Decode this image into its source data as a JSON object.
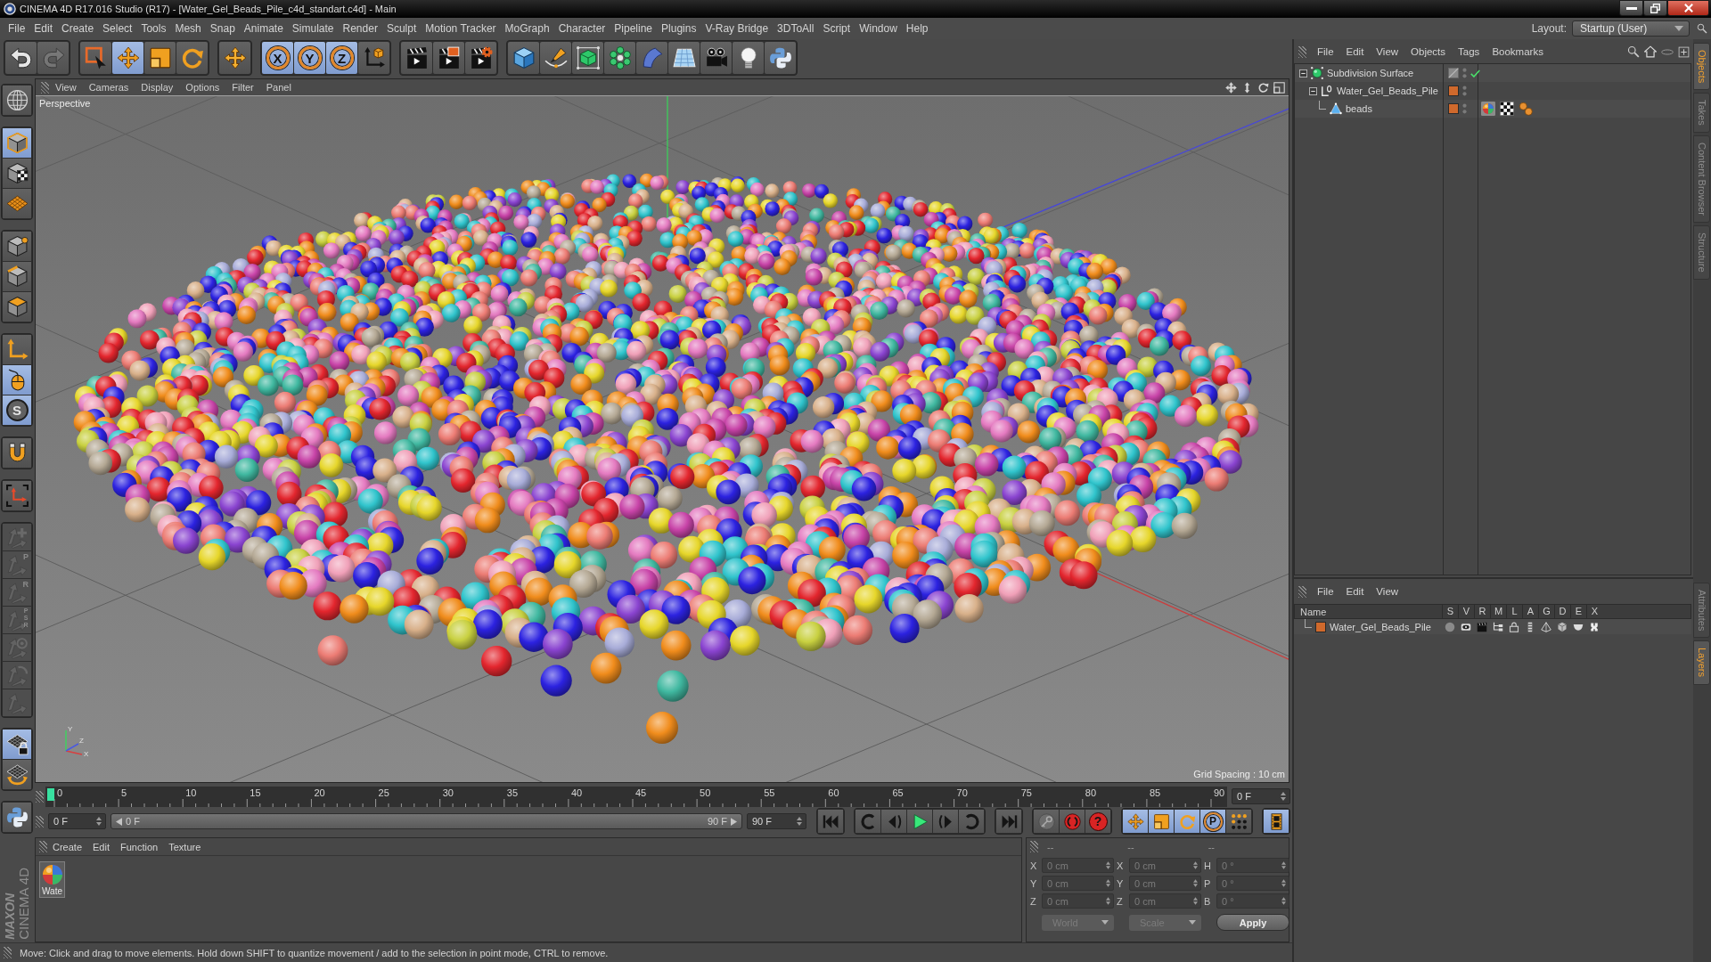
{
  "window": {
    "title": "CINEMA 4D R17.016 Studio (R17) - [Water_Gel_Beads_Pile_c4d_standart.c4d] - Main"
  },
  "menu_bar": {
    "items": [
      "File",
      "Edit",
      "Create",
      "Select",
      "Tools",
      "Mesh",
      "Snap",
      "Animate",
      "Simulate",
      "Render",
      "Sculpt",
      "Motion Tracker",
      "MoGraph",
      "Character",
      "Pipeline",
      "Plugins",
      "V-Ray Bridge",
      "3DToAll",
      "Script",
      "Window",
      "Help"
    ],
    "layout_label": "Layout:",
    "layout_value": "Startup (User)"
  },
  "toolbar": {
    "groups": [
      [
        {
          "active": false,
          "disabled": false
        },
        {
          "active": false,
          "disabled": true
        }
      ],
      [
        {
          "active": false,
          "disabled": false
        },
        {
          "active": true,
          "disabled": false
        },
        {
          "active": false,
          "disabled": false
        },
        {
          "active": false,
          "disabled": false
        }
      ],
      [
        {
          "active": false,
          "disabled": false
        }
      ],
      [
        {
          "label": "X",
          "active": true,
          "disabled": false
        },
        {
          "label": "Y",
          "active": true,
          "disabled": false
        },
        {
          "label": "Z",
          "active": true,
          "disabled": false
        },
        {
          "active": false,
          "disabled": false
        }
      ],
      [
        {
          "active": false,
          "disabled": false
        },
        {
          "active": false,
          "disabled": false
        },
        {
          "active": false,
          "disabled": false
        }
      ],
      [
        {
          "active": false,
          "disabled": false
        },
        {
          "active": false,
          "disabled": false
        },
        {
          "active": false,
          "disabled": false
        },
        {
          "active": false,
          "disabled": false
        },
        {
          "active": false,
          "disabled": false
        },
        {
          "active": false,
          "disabled": false
        },
        {
          "active": false,
          "disabled": false
        },
        {
          "active": false,
          "disabled": false
        },
        {
          "active": false,
          "disabled": false
        }
      ]
    ]
  },
  "tool_palette": {
    "groups": [
      [
        {
          "active": false,
          "disabled": false
        }
      ],
      [
        {
          "active": true,
          "disabled": false
        },
        {
          "active": false,
          "disabled": false
        },
        {
          "active": false,
          "disabled": false
        }
      ],
      [
        {
          "active": false,
          "disabled": false
        },
        {
          "active": false,
          "disabled": false
        },
        {
          "active": false,
          "disabled": false
        }
      ],
      [
        {
          "active": false,
          "disabled": false
        },
        {
          "active": true,
          "disabled": false
        },
        {
          "label": "S",
          "active": true,
          "disabled": false
        }
      ],
      [
        {
          "active": false,
          "disabled": false
        }
      ],
      [
        {
          "active": false,
          "disabled": false
        }
      ],
      [
        {
          "disabled": true
        },
        {
          "label": "P",
          "disabled": true
        },
        {
          "label": "R",
          "disabled": true
        },
        {
          "label": "PSR",
          "disabled": true
        },
        {
          "disabled": true
        },
        {
          "disabled": true
        },
        {
          "disabled": true
        }
      ],
      [
        {
          "active": true,
          "disabled": false
        },
        {
          "active": false,
          "disabled": false
        }
      ],
      [
        {
          "active": false,
          "disabled": false
        }
      ]
    ]
  },
  "viewport": {
    "menu": [
      "View",
      "Cameras",
      "Display",
      "Options",
      "Filter",
      "Panel"
    ],
    "camera": "Perspective",
    "grid_spacing": "Grid Spacing : 10 cm",
    "axis_labels": [
      "Y",
      "Z",
      "X"
    ]
  },
  "timeline": {
    "ticks": [
      "0",
      "5",
      "10",
      "15",
      "20",
      "25",
      "30",
      "35",
      "40",
      "45",
      "50",
      "55",
      "60",
      "65",
      "70",
      "75",
      "80",
      "85",
      "90"
    ],
    "level": 0,
    "current_frame": "0 F"
  },
  "frame_range": {
    "start": "0 F",
    "range_start": "0 F",
    "range_end": "90 F",
    "end": "90 F"
  },
  "playback": {
    "groups": [
      [
        {
          "active": false
        }
      ],
      [
        {
          "active": false
        },
        {
          "active": false
        },
        {
          "active": false
        },
        {
          "active": false
        },
        {
          "active": false
        }
      ],
      [
        {
          "active": false
        }
      ],
      [
        {
          "active": false
        },
        {
          "active": false
        },
        {
          "label": "?",
          "active": false
        }
      ],
      [
        {
          "active": true
        },
        {
          "active": true
        },
        {
          "active": true
        },
        {
          "label": "P",
          "active": true
        },
        {
          "active": false
        }
      ],
      [
        {
          "active": true
        }
      ]
    ]
  },
  "material_manager": {
    "menu": [
      "Create",
      "Edit",
      "Function",
      "Texture"
    ],
    "materials": [
      {
        "name": "Wate"
      }
    ]
  },
  "coordinates": {
    "disabled": true,
    "headers": [
      "--",
      "--",
      "--"
    ],
    "rows": [
      {
        "labels": [
          "X",
          "X",
          "H"
        ],
        "values": [
          "0 cm",
          "0 cm",
          "0 °"
        ]
      },
      {
        "labels": [
          "Y",
          "Y",
          "P"
        ],
        "values": [
          "0 cm",
          "0 cm",
          "0 °"
        ]
      },
      {
        "labels": [
          "Z",
          "Z",
          "B"
        ],
        "values": [
          "0 cm",
          "0 cm",
          "0 °"
        ]
      }
    ],
    "space": "World",
    "mode": "Scale",
    "apply": "Apply"
  },
  "status_bar": {
    "text": "Move: Click and drag to move elements. Hold down SHIFT to quantize movement / add to the selection in point mode, CTRL to remove."
  },
  "object_manager": {
    "menu": [
      "File",
      "Edit",
      "View",
      "Objects",
      "Tags",
      "Bookmarks"
    ],
    "objects": [
      {
        "kind": "subdivision",
        "name": "Subdivision Surface",
        "expanded": true,
        "enabled": true,
        "children": [
          {
            "kind": "null",
            "name": "Water_Gel_Beads_Pile",
            "expanded": true,
            "color": "#d0692c",
            "children": [
              {
                "kind": "polygon",
                "name": "beads",
                "color": "#d0692c",
                "tags": [
                  {
                    "kind": "material"
                  },
                  {
                    "kind": "texture"
                  },
                  {
                    "kind": "selection"
                  }
                ]
              }
            ]
          }
        ]
      }
    ]
  },
  "layer_manager": {
    "menu": [
      "File",
      "Edit",
      "View"
    ],
    "columns": [
      "Name",
      "S",
      "V",
      "R",
      "M",
      "L",
      "A",
      "G",
      "D",
      "E",
      "X"
    ],
    "layers": [
      {
        "name": "Water_Gel_Beads_Pile",
        "color": "#d0692c"
      }
    ]
  },
  "side_tabs": {
    "top": [
      {
        "label": "Objects",
        "selected": true
      },
      {
        "label": "Takes",
        "selected": false
      },
      {
        "label": "Content Browser",
        "selected": false
      },
      {
        "label": "Structure",
        "selected": false
      }
    ],
    "bottom": [
      {
        "label": "Attributes",
        "selected": false
      },
      {
        "label": "Layers",
        "selected": true
      }
    ]
  },
  "logo": {
    "brand": "MAXON",
    "product": "CINEMA 4D"
  }
}
